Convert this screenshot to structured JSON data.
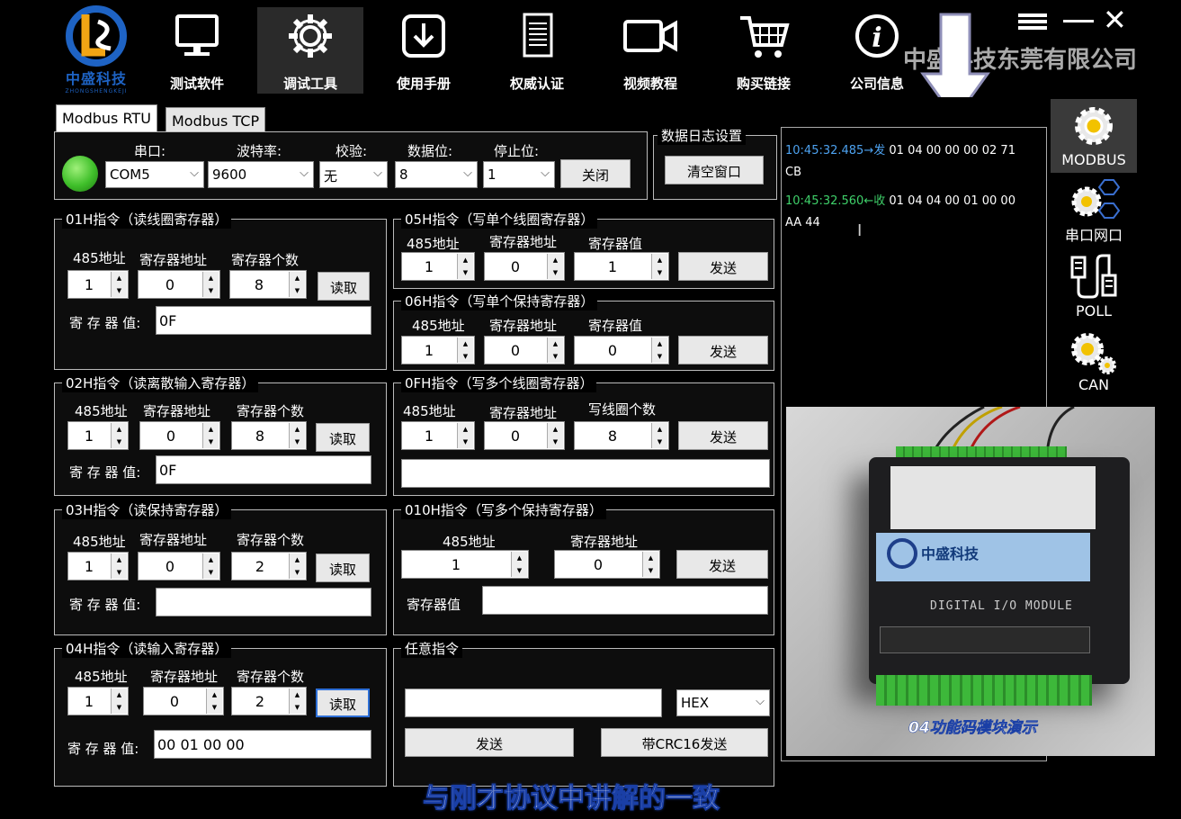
{
  "brand": {
    "cn": "中盛科技",
    "en": "ZHONGSHENGKEJI"
  },
  "watermark": "中盛科技东莞有限公司",
  "nav": [
    {
      "label": "测试软件",
      "icon": "monitor-icon"
    },
    {
      "label": "调试工具",
      "icon": "gear-icon"
    },
    {
      "label": "使用手册",
      "icon": "download-icon"
    },
    {
      "label": "权威认证",
      "icon": "certificate-icon"
    },
    {
      "label": "视频教程",
      "icon": "video-camera-icon"
    },
    {
      "label": "购买链接",
      "icon": "cart-icon"
    },
    {
      "label": "公司信息",
      "icon": "info-icon"
    }
  ],
  "tabs": [
    "Modbus RTU",
    "Modbus TCP"
  ],
  "serial": {
    "labels": {
      "port": "串口:",
      "baud": "波特率:",
      "parity": "校验:",
      "databits": "数据位:",
      "stopbits": "停止位:"
    },
    "port": "COM5",
    "baud": "9600",
    "parity": "无",
    "databits": "8",
    "stopbits": "1",
    "close": "关闭"
  },
  "log_settings": {
    "title": "数据日志设置",
    "clear": "清空窗口"
  },
  "cmd01": {
    "title": "01H指令（读线圈寄存器）",
    "addr_label": "485地址",
    "reg_label": "寄存器地址",
    "cnt_label": "寄存器个数",
    "addr": "1",
    "reg": "0",
    "cnt": "8",
    "read": "读取",
    "val_label": "寄 存 器 值:",
    "val": "0F"
  },
  "cmd02": {
    "title": "02H指令（读离散输入寄存器）",
    "addr_label": "485地址",
    "reg_label": "寄存器地址",
    "cnt_label": "寄存器个数",
    "addr": "1",
    "reg": "0",
    "cnt": "8",
    "read": "读取",
    "val_label": "寄 存 器 值:",
    "val": "0F"
  },
  "cmd03": {
    "title": "03H指令（读保持寄存器）",
    "addr_label": "485地址",
    "reg_label": "寄存器地址",
    "cnt_label": "寄存器个数",
    "addr": "1",
    "reg": "0",
    "cnt": "2",
    "read": "读取",
    "val_label": "寄 存 器 值:",
    "val": ""
  },
  "cmd04": {
    "title": "04H指令（读输入寄存器）",
    "addr_label": "485地址",
    "reg_label": "寄存器地址",
    "cnt_label": "寄存器个数",
    "addr": "1",
    "reg": "0",
    "cnt": "2",
    "read": "读取",
    "val_label": "寄 存 器 值:",
    "val": "00 01 00 00"
  },
  "cmd05": {
    "title": "05H指令（写单个线圈寄存器）",
    "addr_label": "485地址",
    "reg_label": "寄存器地址",
    "val_label": "寄存器值",
    "addr": "1",
    "reg": "0",
    "val": "1",
    "send": "发送"
  },
  "cmd06": {
    "title": "06H指令（写单个保持寄存器）",
    "addr_label": "485地址",
    "reg_label": "寄存器地址",
    "val_label": "寄存器值",
    "addr": "1",
    "reg": "0",
    "val": "0",
    "send": "发送"
  },
  "cmd0f": {
    "title": "0FH指令（写多个线圈寄存器）",
    "addr_label": "485地址",
    "reg_label": "寄存器地址",
    "cnt_label": "写线圈个数",
    "addr": "1",
    "reg": "0",
    "cnt": "8",
    "send": "发送",
    "data": ""
  },
  "cmd10": {
    "title": "010H指令（写多个保持寄存器）",
    "addr_label": "485地址",
    "reg_label": "寄存器地址",
    "addr": "1",
    "reg": "0",
    "send": "发送",
    "val_label": "寄存器值",
    "val": ""
  },
  "anycmd": {
    "title": "任意指令",
    "input": "",
    "format": "HEX",
    "send": "发送",
    "send_crc": "带CRC16发送"
  },
  "log": [
    {
      "ts": "10:45:32.485",
      "dir": "→发",
      "data": "01 04 00 00 00 02 71"
    },
    {
      "cont": "CB"
    },
    {
      "ts": "10:45:32.560",
      "dir": "←收",
      "data": "01 04 04 00 01 00 00"
    },
    {
      "cont": "AA 44"
    }
  ],
  "side": [
    {
      "label": "MODBUS",
      "icon": "gear-icon"
    },
    {
      "label": "串口网口",
      "icon": "gears-icon"
    },
    {
      "label": "POLL",
      "icon": "poll-icon"
    },
    {
      "label": "CAN",
      "icon": "gear-icon"
    }
  ],
  "photo": {
    "logo": "中盛科技",
    "module_text": "DIGITAL I/O MODULE",
    "caption": "04功能码模块演示"
  },
  "subtitle": "与刚才协议中讲解的一致",
  "accent": "#2e6fd6",
  "led_color": "#3fbf2a"
}
